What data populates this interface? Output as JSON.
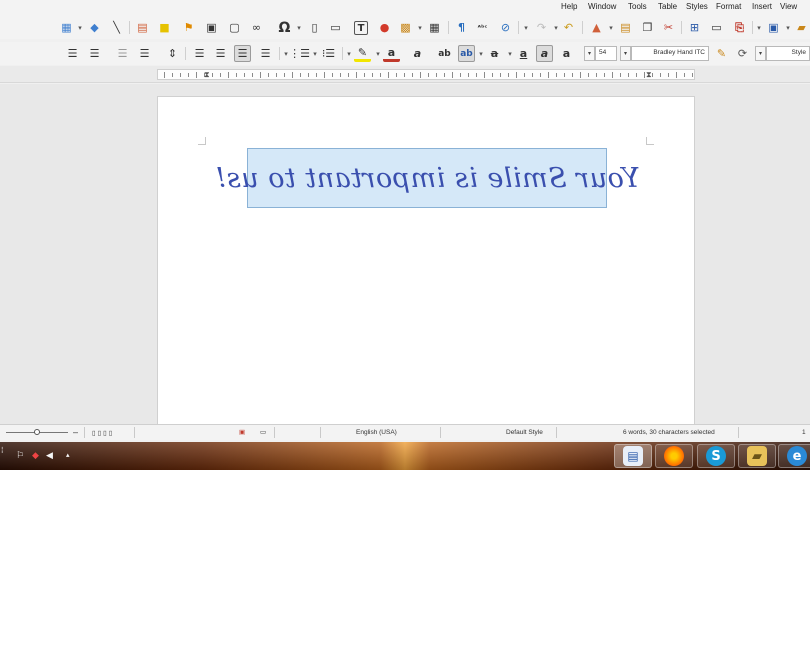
{
  "menu": {
    "items": [
      "View",
      "Insert",
      "Format",
      "Styles",
      "Table",
      "Tools",
      "Window",
      "Help"
    ]
  },
  "toolbar1": {
    "icons": [
      "insert-image-icon",
      "basic-shapes-icon",
      "line-icon",
      "insert-chart-icon",
      "note-icon",
      "bookmark-icon",
      "cross-reference-icon",
      "comment-icon",
      "hyperlink-icon",
      "special-character-icon",
      "insert-field-icon",
      "insert-frame-icon",
      "text-box-icon",
      "insert-chart-pie-icon",
      "image-icon",
      "insert-table-icon",
      "formatting-marks-icon",
      "spelling-icon",
      "find-replace-icon",
      "redo-icon",
      "undo-icon",
      "paste-icon",
      "clone-formatting-icon",
      "copy-icon",
      "cut-icon",
      "print-preview-icon",
      "print-icon",
      "export-pdf-icon",
      "save-icon",
      "open-icon",
      "new-icon"
    ]
  },
  "toolbar2": {
    "paragraph_style": "Style",
    "font_name": "Bradley Hand ITC",
    "font_size": "54",
    "icons": [
      "align-right-icon",
      "align-center-icon",
      "align-left-icon",
      "justify-icon",
      "line-spacing-icon",
      "paragraph-spacing-icon",
      "indent-icon",
      "outdent-icon",
      "bullets-icon",
      "numbering-icon",
      "highlight-icon",
      "font-color-icon",
      "clear-formatting-icon",
      "shadow-icon",
      "subscript-icon",
      "superscript-icon",
      "strikethrough-icon",
      "underline-icon",
      "italic-icon",
      "bold-icon"
    ]
  },
  "document": {
    "text": "Your Smile is important to us!"
  },
  "statusbar": {
    "page_info": "1",
    "word_count": "6 words, 30 characters selected",
    "page_style": "Default Style",
    "language": "English (USA)"
  },
  "taskbar": {
    "apps": [
      "ie-icon",
      "file-explorer-icon",
      "skype-icon",
      "firefox-icon",
      "writer-icon"
    ],
    "active_app": "writer-icon"
  },
  "colors": {
    "selection": "#d5e8f8",
    "text": "#3a4fae",
    "taskbar_glow": "#f0a23c"
  }
}
